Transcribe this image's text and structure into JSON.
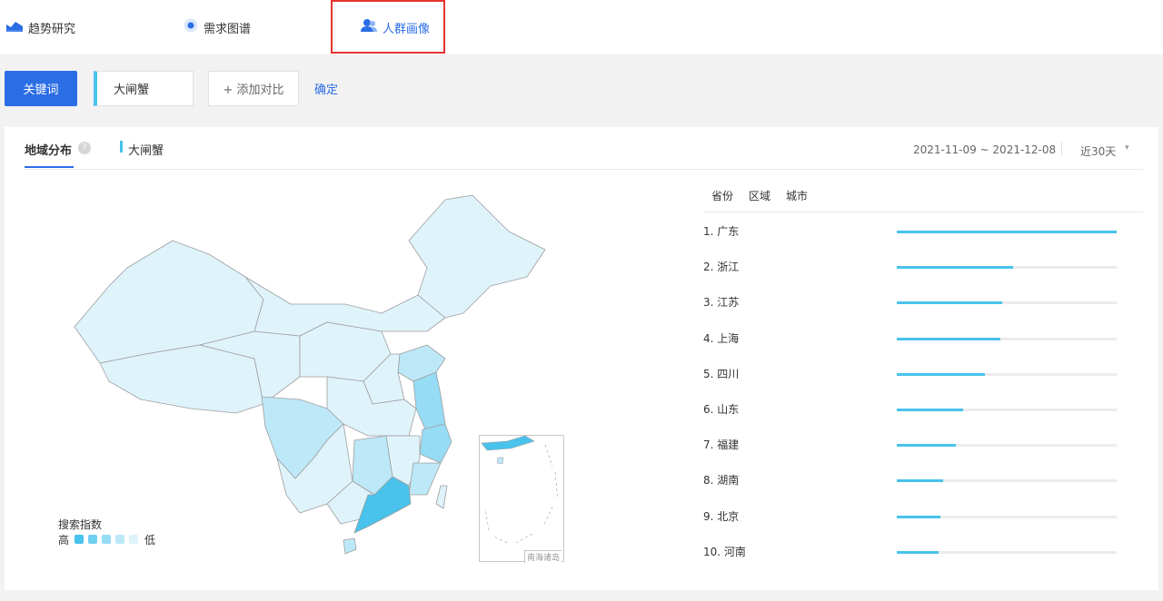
{
  "nav": {
    "tabs": [
      {
        "label": "趋势研究",
        "icon": "trend-chart-icon"
      },
      {
        "label": "需求图谱",
        "icon": "radar-dot-icon"
      },
      {
        "label": "人群画像",
        "icon": "user-group-icon",
        "active": true
      }
    ]
  },
  "search": {
    "keyword_button": "关键词",
    "keyword_value": "大闸蟹",
    "add_compare": "+ 添加对比",
    "confirm": "确定"
  },
  "panel": {
    "title": "地域分布",
    "help_icon": "?",
    "legend_keyword": "大闸蟹",
    "date_range": "2021-11-09 ~ 2021-12-08",
    "period": "近30天",
    "period_caret": "▾"
  },
  "map": {
    "legend_title": "搜索指数",
    "legend_high": "高",
    "legend_low": "低",
    "scale_colors": [
      "#49c2ec",
      "#6fcff1",
      "#96dcf5",
      "#bde8f8",
      "#dff3fb"
    ],
    "inset_label": "南海诸岛",
    "colors": {
      "border": "#9e9e9e",
      "base": "#dff3fb"
    }
  },
  "ranking": {
    "tabs": [
      "省份",
      "区域",
      "城市"
    ],
    "accent": "#49c2ec",
    "items": [
      {
        "label": "1.  广东",
        "value": 1.0
      },
      {
        "label": "2.  浙江",
        "value": 0.53
      },
      {
        "label": "3.  江苏",
        "value": 0.48
      },
      {
        "label": "4.  上海",
        "value": 0.47
      },
      {
        "label": "5.  四川",
        "value": 0.4
      },
      {
        "label": "6.  山东",
        "value": 0.3
      },
      {
        "label": "7.  福建",
        "value": 0.27
      },
      {
        "label": "8.  湖南",
        "value": 0.21
      },
      {
        "label": "9.  北京",
        "value": 0.2
      },
      {
        "label": "10. 河南",
        "value": 0.19
      }
    ]
  }
}
